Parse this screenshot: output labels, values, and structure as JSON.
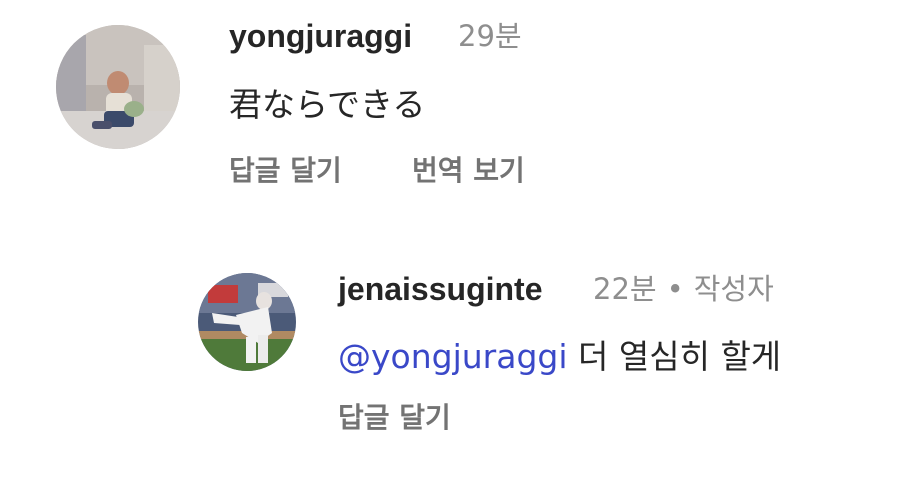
{
  "comments": [
    {
      "username": "yongjuraggi",
      "time": "29분",
      "text": "君ならできる",
      "actions": {
        "reply": "답글 달기",
        "translate": "번역 보기"
      }
    }
  ],
  "reply": {
    "username": "jenaissuginte",
    "time": "22분",
    "separator": "•",
    "author_badge": "작성자",
    "mention": "@yongjuraggi",
    "text": "더 열심히 할게",
    "actions": {
      "reply": "답글 달기"
    }
  },
  "colors": {
    "text": "#262626",
    "meta": "#8e8e8e",
    "action": "#737373",
    "mention": "#3a48c8"
  }
}
